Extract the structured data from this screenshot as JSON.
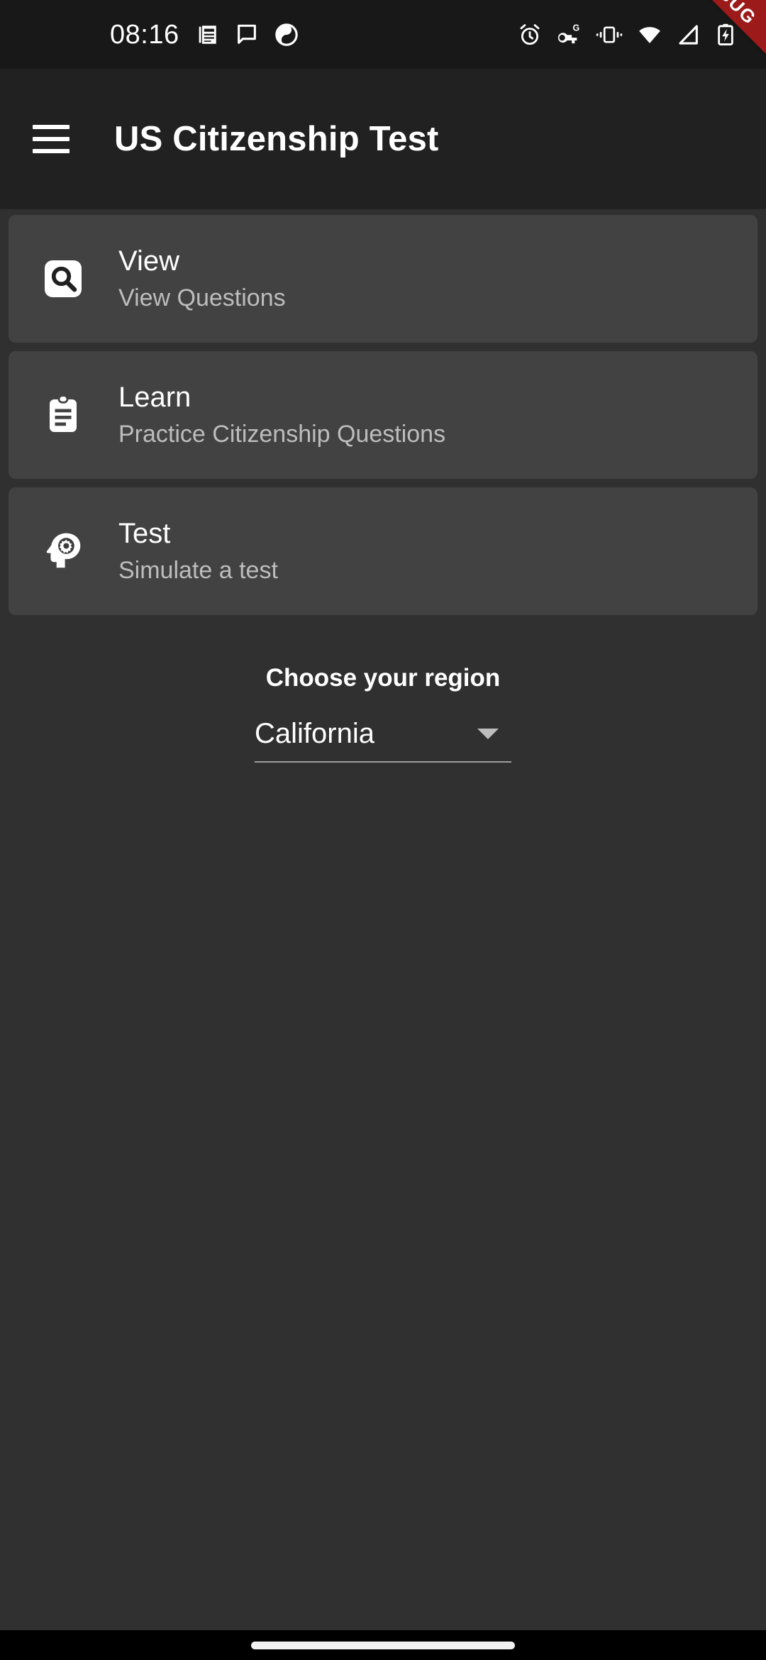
{
  "status_bar": {
    "clock": "08:16",
    "left_icons": [
      "news-icon",
      "chat-bubble-icon",
      "contrast-circle-icon"
    ],
    "right_icons": [
      "alarm-icon",
      "vpn-key-icon",
      "vibrate-icon",
      "wifi-icon",
      "cell-signal-icon",
      "battery-charging-icon"
    ],
    "background": "#181818"
  },
  "debug_banner": {
    "label": "DEBUG",
    "color": "#9c1a1a"
  },
  "app_bar": {
    "title": "US Citizenship Test",
    "menu_icon": "hamburger-menu-icon",
    "background": "#212121"
  },
  "cards": [
    {
      "title": "View",
      "subtitle": "View Questions",
      "icon": "search-box-icon"
    },
    {
      "title": "Learn",
      "subtitle": "Practice Citizenship Questions",
      "icon": "clipboard-assignment-icon"
    },
    {
      "title": "Test",
      "subtitle": "Simulate a test",
      "icon": "psychology-head-gear-icon"
    }
  ],
  "region": {
    "label": "Choose your region",
    "selected": "California",
    "caret_icon": "chevron-down-icon"
  },
  "nav_bar": {
    "gesture_pill": "home-gesture-pill"
  },
  "theme": {
    "background": "#303030",
    "card": "#424242",
    "title_text": "#ffffff",
    "subtitle_text": "#bdbdbd",
    "divider": "#9e9e9e"
  }
}
